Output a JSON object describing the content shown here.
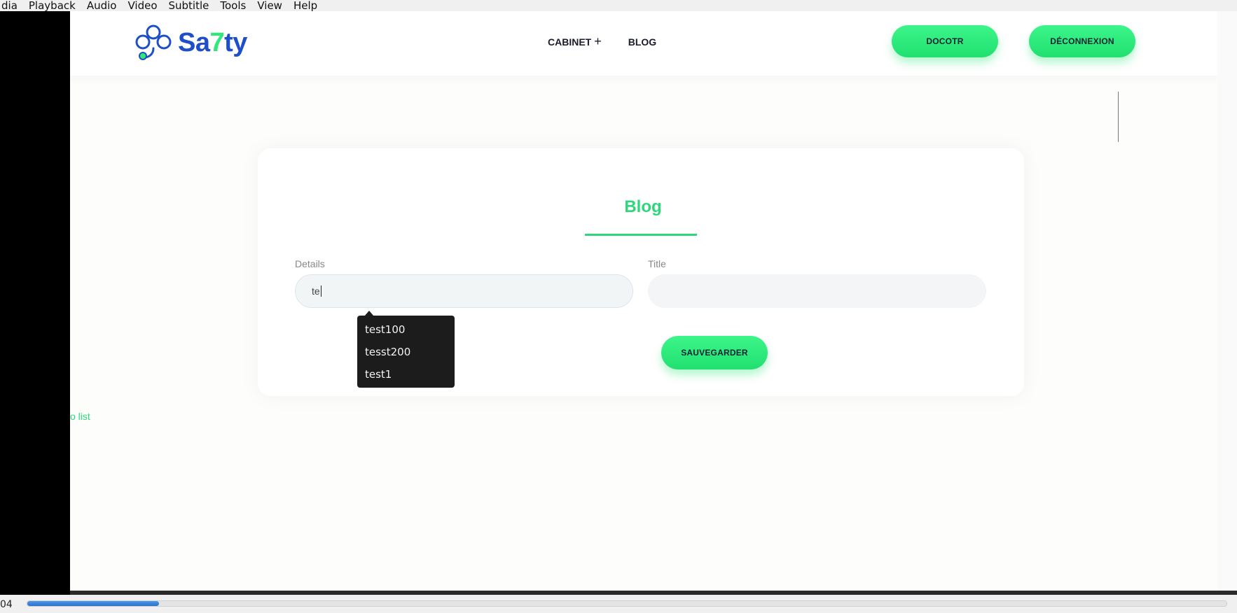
{
  "player": {
    "menu": [
      "dia",
      "Playback",
      "Audio",
      "Video",
      "Subtitle",
      "Tools",
      "View",
      "Help"
    ],
    "time_display": "04",
    "seek_progress_percent": 11
  },
  "site": {
    "logo": {
      "pre": "Sa",
      "seven": "7",
      "post": "ty"
    },
    "nav": {
      "cabinet": "CABINET",
      "cabinet_icon": "+",
      "blog": "BLOG"
    },
    "buttons": {
      "doctor": "DOCOTR",
      "logout": "DÉCONNEXION"
    }
  },
  "form": {
    "title": "Blog",
    "details_label": "Details",
    "details_value": "te",
    "title_label": "Title",
    "title_value": "",
    "save_label": "SAUVEGARDER"
  },
  "autocomplete": [
    "test100",
    "tesst200",
    "test1"
  ],
  "back_link": "o list",
  "colors": {
    "accent": "#2ed87a",
    "brand_blue": "#1f4fc8",
    "button_green": "#2ee878"
  }
}
